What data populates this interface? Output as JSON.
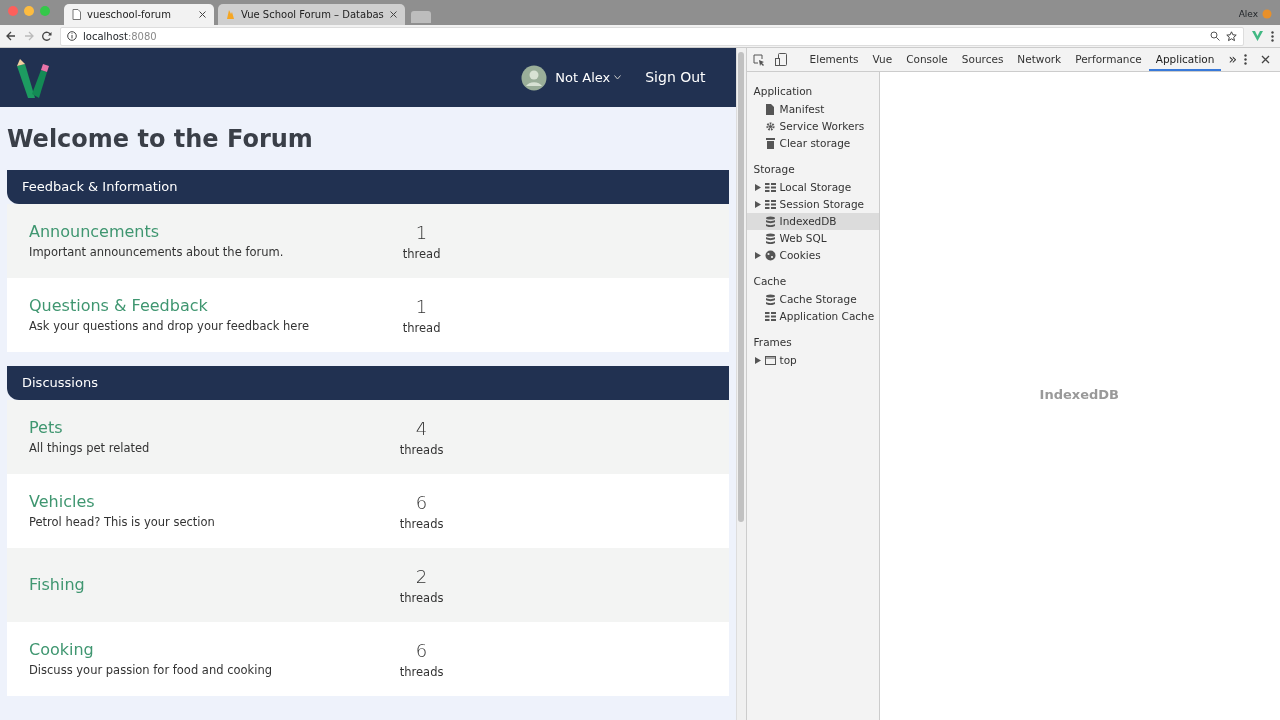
{
  "browser": {
    "tabs": [
      {
        "title": "vueschool-forum",
        "selected": true
      },
      {
        "title": "Vue School Forum – Databas",
        "selected": false
      }
    ],
    "profile": "Alex",
    "address": {
      "host": "localhost",
      "port": ":8080"
    }
  },
  "forum": {
    "user": "Not Alex",
    "sign_out": "Sign Out",
    "heading": "Welcome to the Forum",
    "categories": [
      {
        "title": "Feedback & Information",
        "forums": [
          {
            "name": "Announcements",
            "description": "Important announcements about the forum.",
            "count": "1",
            "unit": "thread"
          },
          {
            "name": "Questions & Feedback",
            "description": "Ask your questions and drop your feedback here",
            "count": "1",
            "unit": "thread"
          }
        ]
      },
      {
        "title": "Discussions",
        "forums": [
          {
            "name": "Pets",
            "description": "All things pet related",
            "count": "4",
            "unit": "threads"
          },
          {
            "name": "Vehicles",
            "description": "Petrol head? This is your section",
            "count": "6",
            "unit": "threads"
          },
          {
            "name": "Fishing",
            "count": "2",
            "unit": "threads"
          },
          {
            "name": "Cooking",
            "description": "Discuss your passion for food and cooking",
            "count": "6",
            "unit": "threads"
          }
        ]
      }
    ]
  },
  "devtools": {
    "tabs": [
      {
        "label": "Elements",
        "selected": false
      },
      {
        "label": "Vue",
        "selected": false
      },
      {
        "label": "Console",
        "selected": false
      },
      {
        "label": "Sources",
        "selected": false
      },
      {
        "label": "Network",
        "selected": false
      },
      {
        "label": "Performance",
        "selected": false
      },
      {
        "label": "Application",
        "selected": true
      }
    ],
    "more": "»",
    "sidebar": [
      {
        "title": "Application",
        "items": [
          {
            "label": "Manifest",
            "kind": "leaf",
            "selected": false
          },
          {
            "label": "Service Workers",
            "kind": "leaf",
            "selected": false
          },
          {
            "label": "Clear storage",
            "kind": "leaf",
            "selected": false
          }
        ]
      },
      {
        "title": "Storage",
        "items": [
          {
            "label": "Local Storage",
            "kind": "expandable",
            "selected": false
          },
          {
            "label": "Session Storage",
            "kind": "expandable",
            "selected": false
          },
          {
            "label": "IndexedDB",
            "kind": "leaf",
            "selected": true
          },
          {
            "label": "Web SQL",
            "kind": "leaf",
            "selected": false
          },
          {
            "label": "Cookies",
            "kind": "expandable",
            "selected": false
          }
        ]
      },
      {
        "title": "Cache",
        "items": [
          {
            "label": "Cache Storage",
            "kind": "leaf",
            "selected": false
          },
          {
            "label": "Application Cache",
            "kind": "leaf",
            "selected": false
          }
        ]
      },
      {
        "title": "Frames",
        "items": [
          {
            "label": "top",
            "kind": "expandable",
            "selected": false
          }
        ]
      }
    ],
    "panel_title": "IndexedDB"
  }
}
